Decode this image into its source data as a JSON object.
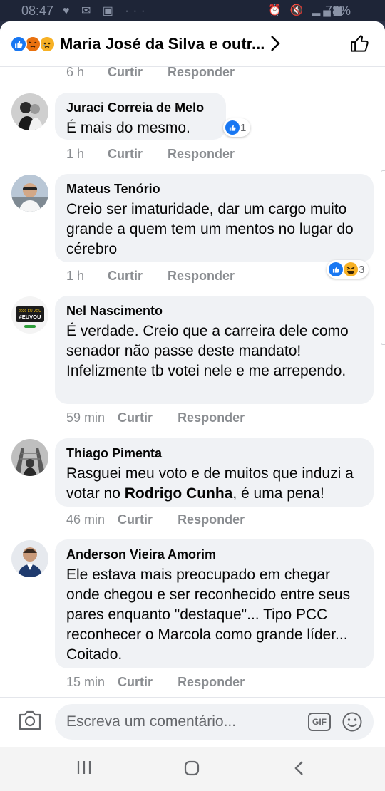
{
  "status_bar": {
    "time": "08:47",
    "left_icons": "♥ ✉ ▣ ···",
    "right_icons": "⏰ 🔇 ▂▄▆",
    "battery": "78%"
  },
  "header": {
    "title": "Maria José da Silva e outr...",
    "reactions": [
      "like-icon",
      "angry-icon",
      "sad-icon"
    ]
  },
  "actions_labels": {
    "like": "Curtir",
    "reply": "Responder"
  },
  "top_partial": {
    "time": "6 h"
  },
  "comments": [
    {
      "author": "Juraci Correia de Melo",
      "text": "É mais do mesmo.",
      "time": "1 h",
      "reactions": {
        "icons": [
          "like-icon"
        ],
        "count": "1"
      }
    },
    {
      "author": "Mateus Tenório",
      "text": "Creio ser imaturidade, dar um cargo muito grande a quem tem um mentos no lugar do cérebro",
      "time": "1 h",
      "reactions": {
        "icons": [
          "like-icon",
          "haha-icon"
        ],
        "count": "3"
      }
    },
    {
      "author": "Nel Nascimento",
      "text": "É verdade. Creio que a carreira dele como senador não passe deste mandato! Infelizmente tb votei nele e me arrependo.",
      "time": "59 min"
    },
    {
      "author": "Thiago Pimenta",
      "text_before": "Rasguei meu voto e de muitos que induzi a votar no ",
      "text_mention": "Rodrigo Cunha",
      "text_after": ", é uma pena!",
      "time": "46 min"
    },
    {
      "author": "Anderson Vieira Amorim",
      "text": "Ele estava mais preocupado em chegar onde chegou e ser reconhecido entre seus pares enquanto \"destaque\"... Tipo PCC reconhecer o Marcola como grande líder... Coitado.",
      "time": "15 min"
    }
  ],
  "avatar_badge": "#EUVOU",
  "composer": {
    "placeholder": "Escreva um comentário...",
    "gif_label": "GIF"
  },
  "colors": {
    "like": "#1877f2",
    "angry": "#e9710f",
    "sad": "#f7b125",
    "bubble": "#f0f2f5",
    "meta": "#8a8d91"
  }
}
